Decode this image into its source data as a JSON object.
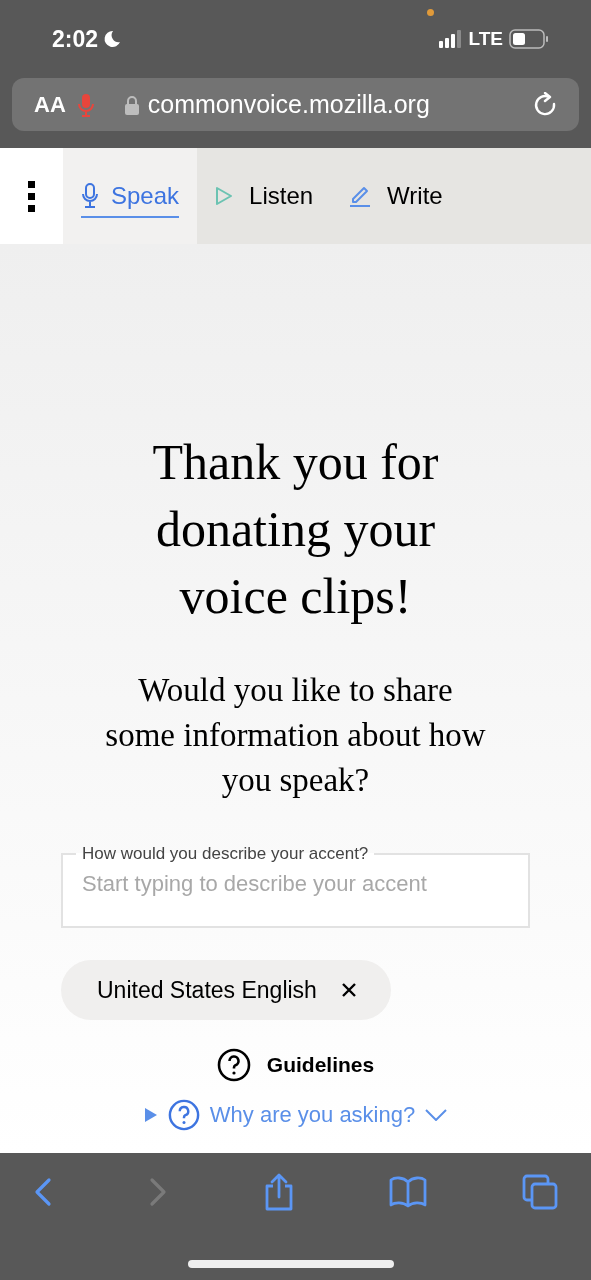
{
  "status_bar": {
    "time": "2:02",
    "network": "LTE"
  },
  "address_bar": {
    "text_size_button": "AA",
    "url": "commonvoice.mozilla.org"
  },
  "tabs": [
    {
      "kind": "speak",
      "label": "Speak",
      "selected": true
    },
    {
      "kind": "listen",
      "label": "Listen",
      "selected": false
    },
    {
      "kind": "write",
      "label": "Write",
      "selected": false
    }
  ],
  "heading": "Thank you for donating your voice clips!",
  "subheading": "Would you like to share some information about how you speak?",
  "accent_field": {
    "label": "How would you describe your accent?",
    "placeholder": "Start typing to describe your accent"
  },
  "accent_chips": [
    {
      "label": "United States English"
    }
  ],
  "guidelines_link": "Guidelines",
  "why_asking_link": "Why are you asking?",
  "toolbar": [
    {
      "kind": "back",
      "disabled": false
    },
    {
      "kind": "forward",
      "disabled": true
    },
    {
      "kind": "share",
      "disabled": false
    },
    {
      "kind": "bookmarks",
      "disabled": false
    },
    {
      "kind": "tabs",
      "disabled": false
    }
  ]
}
